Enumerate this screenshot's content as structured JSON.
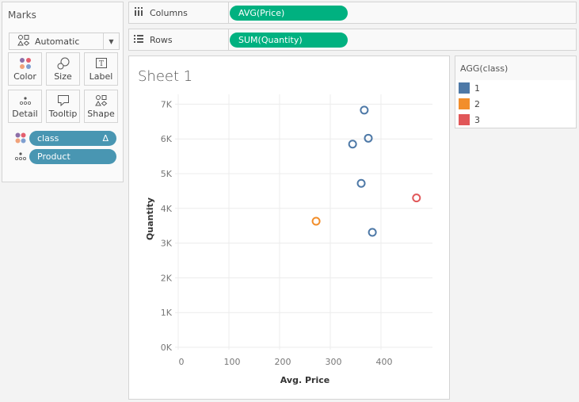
{
  "marks": {
    "title": "Marks",
    "mark_type": "Automatic",
    "cards": [
      {
        "id": "color",
        "label": "Color",
        "icon": "color-icon"
      },
      {
        "id": "size",
        "label": "Size",
        "icon": "size-icon"
      },
      {
        "id": "label",
        "label": "Label",
        "icon": "label-icon"
      },
      {
        "id": "detail",
        "label": "Detail",
        "icon": "detail-icon"
      },
      {
        "id": "tooltip",
        "label": "Tooltip",
        "icon": "tooltip-icon"
      },
      {
        "id": "shape",
        "label": "Shape",
        "icon": "shape-icon"
      }
    ],
    "fields": [
      {
        "label": "class",
        "encoding": "color",
        "badge": "Δ"
      },
      {
        "label": "Product",
        "encoding": "detail",
        "badge": ""
      }
    ]
  },
  "shelves": {
    "columns": {
      "label": "Columns",
      "pill": "AVG(Price)"
    },
    "rows": {
      "label": "Rows",
      "pill": "SUM(Quantity)"
    }
  },
  "sheet": {
    "title": "Sheet 1"
  },
  "legend": {
    "title": "AGG(class)",
    "items": [
      {
        "label": "1",
        "color": "#4e79a7"
      },
      {
        "label": "2",
        "color": "#f28e2b"
      },
      {
        "label": "3",
        "color": "#e15759"
      }
    ]
  },
  "chart_data": {
    "type": "scatter",
    "title": "Sheet 1",
    "xlabel": "Avg. Price",
    "ylabel": "Quantity",
    "xlim": [
      0,
      500
    ],
    "ylim": [
      -150,
      7200
    ],
    "xticks": [
      0,
      100,
      200,
      300,
      400
    ],
    "xtick_labels": [
      "0",
      "100",
      "200",
      "300",
      "400"
    ],
    "yticks": [
      0,
      1000,
      2000,
      3000,
      4000,
      5000,
      6000,
      7000
    ],
    "ytick_labels": [
      "0K",
      "1K",
      "2K",
      "3K",
      "4K",
      "5K",
      "6K",
      "7K"
    ],
    "grid": true,
    "legend": "right",
    "points": [
      {
        "x": 367,
        "y": 6830,
        "class": "1"
      },
      {
        "x": 375,
        "y": 6020,
        "class": "1"
      },
      {
        "x": 344,
        "y": 5850,
        "class": "1"
      },
      {
        "x": 361,
        "y": 4720,
        "class": "1"
      },
      {
        "x": 383,
        "y": 3310,
        "class": "1"
      },
      {
        "x": 272,
        "y": 3630,
        "class": "2"
      },
      {
        "x": 470,
        "y": 4300,
        "class": "3"
      }
    ],
    "class_colors": {
      "1": "#4e79a7",
      "2": "#f28e2b",
      "3": "#e15759"
    }
  }
}
